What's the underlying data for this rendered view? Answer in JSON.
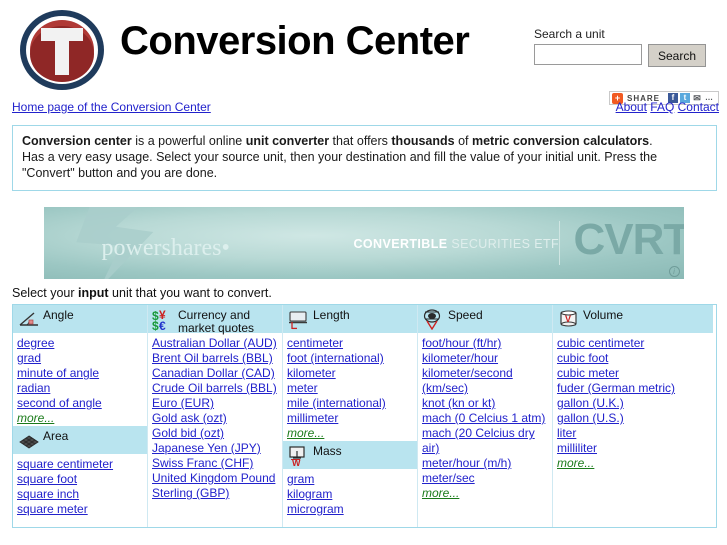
{
  "header": {
    "site_title": "Conversion Center",
    "logo_letter": "T",
    "search_label": "Search a unit",
    "search_value": "",
    "search_placeholder": "",
    "search_button": "Search"
  },
  "share": {
    "plus": "+",
    "label": "SHARE",
    "facebook": "f",
    "twitter": "t",
    "mail": "✉",
    "more": "…"
  },
  "nav": {
    "home_link": "Home page of the Conversion Center",
    "about": "About",
    "faq": "FAQ",
    "contact": "Contact"
  },
  "description": {
    "b1": "Conversion center",
    "t1": " is a powerful online ",
    "b2": "unit converter",
    "t2": " that offers ",
    "b3": "thousands",
    "t3": " of ",
    "b4": "metric conversion calculators",
    "t4": ".",
    "line2": "Has a very easy usage. Select your source unit, then your destination and fill the value of your initial unit. Press the \"Convert\" button and you are done."
  },
  "banner": {
    "brand": "powershares•",
    "mid_bold": "CONVERTIBLE",
    "mid_light": " SECURITIES ETF",
    "ticker": "CVRT",
    "info": "i"
  },
  "select_line": {
    "t1": "Select your ",
    "bold": "input",
    "t2": " unit that you want to convert."
  },
  "columns": [
    {
      "categories": [
        {
          "icon": "angle-icon",
          "name": "Angle",
          "units": [
            "degree",
            "grad",
            "minute of angle",
            "radian",
            "second of angle"
          ],
          "more": "more..."
        },
        {
          "icon": "area-icon",
          "name": "Area",
          "units": [
            "square centimeter",
            "square foot",
            "square inch",
            "square meter"
          ],
          "more": null
        }
      ]
    },
    {
      "categories": [
        {
          "icon": "currency-icon",
          "name": "Currency and market quotes",
          "units": [
            "Australian Dollar (AUD)",
            "Brent Oil barrels (BBL)",
            "Canadian Dollar (CAD)",
            "Crude Oil barrels (BBL)",
            "Euro (EUR)",
            "Gold ask (ozt)",
            "Gold bid (ozt)",
            "Japanese Yen (JPY)",
            "Swiss Franc (CHF)",
            "United Kingdom Pound Sterling (GBP)"
          ],
          "more": null
        }
      ]
    },
    {
      "categories": [
        {
          "icon": "length-icon",
          "name": "Length",
          "units": [
            "centimeter",
            "foot (international)",
            "kilometer",
            "meter",
            "mile (international)",
            "millimeter"
          ],
          "more": "more..."
        },
        {
          "icon": "mass-icon",
          "name": "Mass",
          "units": [
            "gram",
            "kilogram",
            "microgram"
          ],
          "more": null
        }
      ]
    },
    {
      "categories": [
        {
          "icon": "speed-icon",
          "name": "Speed",
          "units": [
            "foot/hour (ft/hr)",
            "kilometer/hour",
            "kilometer/second (km/sec)",
            "knot (kn or kt)",
            "mach (0 Celcius 1 atm)",
            "mach (20 Celcius dry air)",
            "meter/hour (m/h)",
            "meter/sec"
          ],
          "more": "more..."
        }
      ]
    },
    {
      "categories": [
        {
          "icon": "volume-icon",
          "name": "Volume",
          "units": [
            "cubic centimeter",
            "cubic foot",
            "cubic meter",
            "fuder (German metric)",
            "gallon (U.K.)",
            "gallon (U.S.)",
            "liter",
            "milliliter"
          ],
          "more": "more..."
        }
      ]
    }
  ],
  "colors": {
    "link": "#2222cc",
    "more_link": "#1a7a1a",
    "panel_header": "#b9e4ef",
    "panel_border": "#9fd8e8",
    "logo_ring": "#1f3b5c",
    "logo_red": "#9b2a2a"
  }
}
